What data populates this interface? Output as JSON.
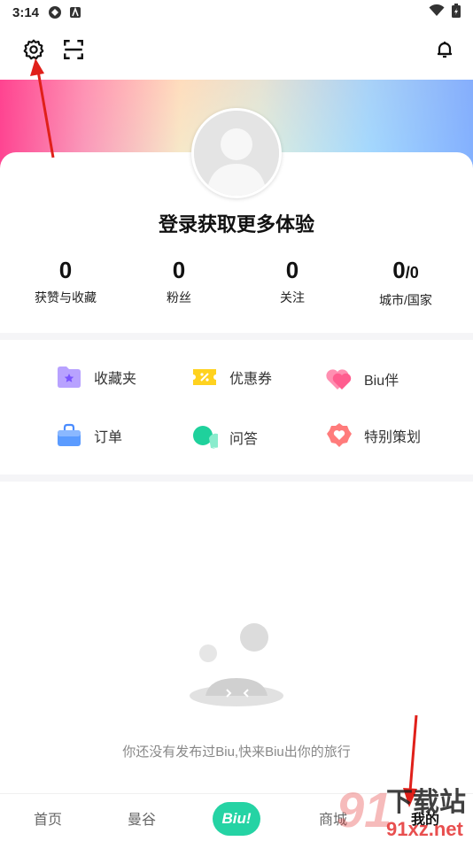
{
  "status_bar": {
    "time": "3:14"
  },
  "profile": {
    "login_prompt": "登录获取更多体验",
    "stats": [
      {
        "value": "0",
        "label": "获赞与收藏"
      },
      {
        "value": "0",
        "label": "粉丝"
      },
      {
        "value": "0",
        "label": "关注"
      },
      {
        "value": "0",
        "value_suffix": "/0",
        "label": "城市/国家"
      }
    ]
  },
  "menu": {
    "items": [
      {
        "label": "收藏夹",
        "icon": "folder-star-icon",
        "color": "#9b7bff"
      },
      {
        "label": "优惠券",
        "icon": "coupon-icon",
        "color": "#ffd21f"
      },
      {
        "label": "Biu伴",
        "icon": "hearts-icon",
        "color": "#ff6f9c"
      },
      {
        "label": "订单",
        "icon": "bag-icon",
        "color": "#4a8cff"
      },
      {
        "label": "问答",
        "icon": "chat-bubble-icon",
        "color": "#1fd19c"
      },
      {
        "label": "特别策划",
        "icon": "heart-badge-icon",
        "color": "#ff6b6b"
      }
    ]
  },
  "empty_state": {
    "message": "你还没有发布过Biu,快来Biu出你的旅行"
  },
  "tabbar": {
    "tabs": [
      {
        "label": "首页"
      },
      {
        "label": "曼谷"
      },
      {
        "label": "Biu!"
      },
      {
        "label": "商城"
      },
      {
        "label": "我的"
      }
    ],
    "active_index": 4
  },
  "watermark": {
    "text_top": "下载站",
    "text_bottom": "91xz.net",
    "number": "91"
  },
  "colors": {
    "accent_green": "#25d3a4",
    "arrow_red": "#e0201a"
  }
}
